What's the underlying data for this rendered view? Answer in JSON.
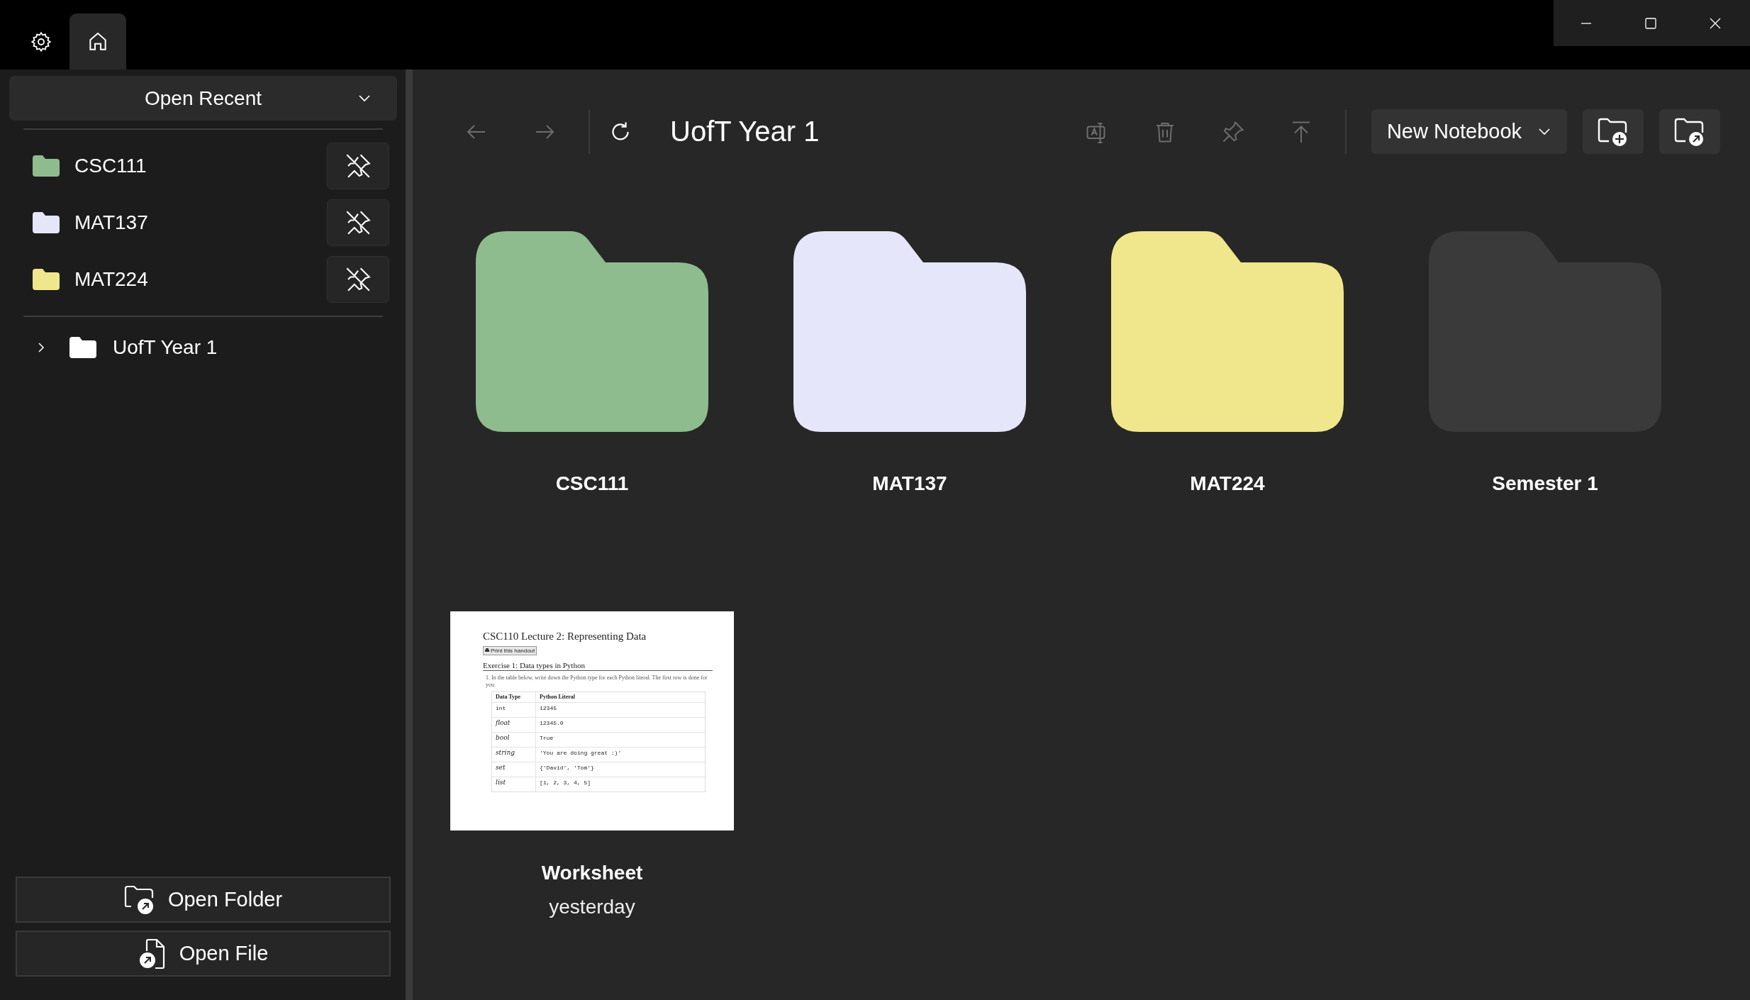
{
  "title_bar": {
    "tabs": [
      {
        "kind": "settings",
        "selected": false
      },
      {
        "kind": "home",
        "selected": true
      }
    ]
  },
  "sidebar": {
    "dropdown": "Open Recent",
    "pinned": [
      {
        "name": "CSC111",
        "color": "#8fbc8f"
      },
      {
        "name": "MAT137",
        "color": "#e6e6fa"
      },
      {
        "name": "MAT224",
        "color": "#f0e68c"
      }
    ],
    "tree": [
      {
        "name": "UofT Year 1",
        "expanded": false
      }
    ],
    "buttons": [
      {
        "label": "Open Folder",
        "kind": "folder"
      },
      {
        "label": "Open File",
        "kind": "file"
      }
    ]
  },
  "toolbar": {
    "title": "UofT Year 1",
    "new_button": "New Notebook",
    "nav": [
      {
        "kind": "back",
        "disabled": true
      },
      {
        "kind": "forward",
        "disabled": true
      }
    ],
    "actions": [
      {
        "kind": "rename",
        "disabled": true
      },
      {
        "kind": "delete",
        "disabled": true
      },
      {
        "kind": "pin",
        "disabled": true
      },
      {
        "kind": "move-up",
        "disabled": true
      }
    ]
  },
  "items": [
    {
      "kind": "folder",
      "name": "CSC111",
      "color": "#8fbc8f"
    },
    {
      "kind": "folder",
      "name": "MAT137",
      "color": "#e6e6fa"
    },
    {
      "kind": "folder",
      "name": "MAT224",
      "color": "#f0e68c"
    },
    {
      "kind": "folder",
      "name": "Semester 1",
      "color": "#3a3a3a"
    },
    {
      "kind": "notebook",
      "name": "Worksheet",
      "date": "yesterday",
      "preview": {
        "title": "CSC110 Lecture 2: Representing Data",
        "print_button": "Print this handout",
        "heading": "Exercise 1: Data types in Python",
        "instruction": "1.  In the table below, write down the Python type for each Python literal. The first row is done for you.",
        "columns": [
          "Data Type",
          "Python Literal"
        ],
        "rows": [
          [
            "int",
            "12345"
          ],
          [
            "float",
            "12345.0"
          ],
          [
            "bool",
            "True"
          ],
          [
            "string",
            "'You are doing great :)'"
          ],
          [
            "set",
            "{'David', 'Tom'}"
          ],
          [
            "list",
            "[1, 2, 3, 4, 5]"
          ]
        ]
      }
    }
  ]
}
